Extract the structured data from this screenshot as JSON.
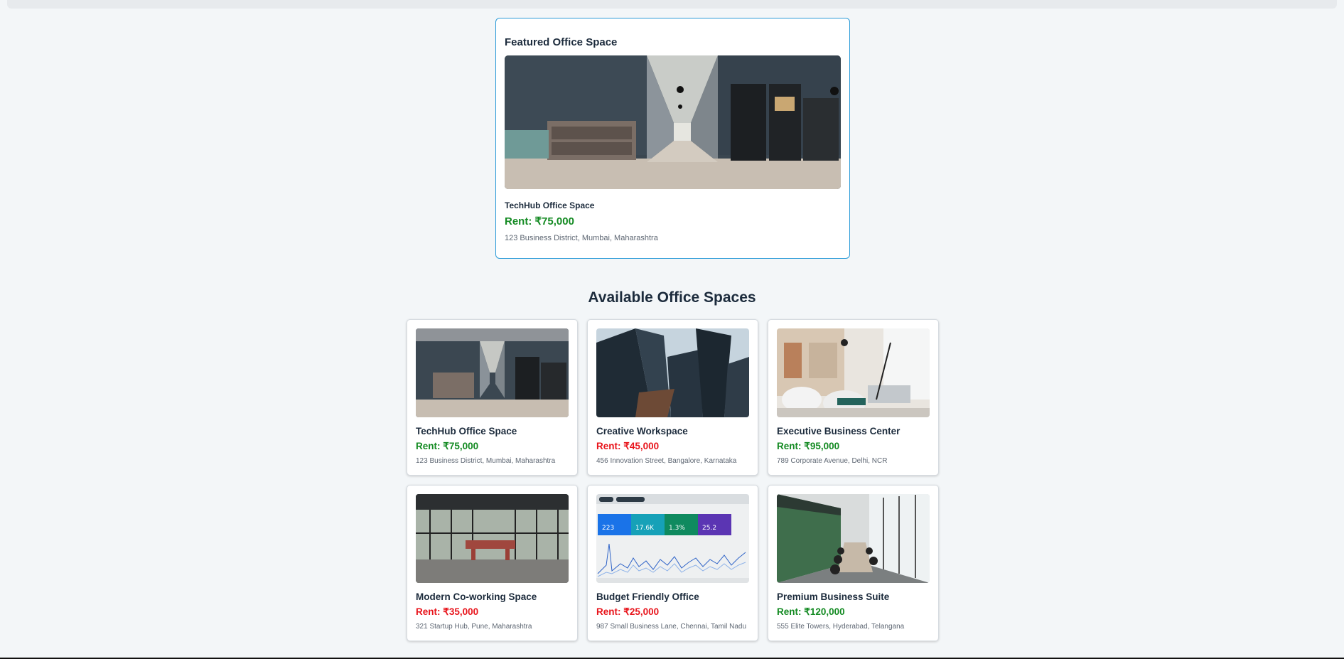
{
  "featured": {
    "heading": "Featured Office Space",
    "name": "TechHub Office Space",
    "rent": "Rent: ₹75,000",
    "address": "123 Business District, Mumbai, Maharashtra",
    "image": "office-corridor-photo"
  },
  "section": {
    "title": "Available Office Spaces"
  },
  "offices": [
    {
      "name": "TechHub Office Space",
      "rent": "Rent: ₹75,000",
      "rent_color": "#138a22",
      "address": "123 Business District, Mumbai, Maharashtra",
      "image": "office-corridor-photo"
    },
    {
      "name": "Creative Workspace",
      "rent": "Rent: ₹45,000",
      "rent_color": "#e8141b",
      "address": "456 Innovation Street, Bangalore, Karnataka",
      "image": "skyscrapers-photo"
    },
    {
      "name": "Executive Business Center",
      "rent": "Rent: ₹95,000",
      "rent_color": "#138a22",
      "address": "789 Corporate Avenue, Delhi, NCR",
      "image": "lounge-chairs-photo"
    },
    {
      "name": "Modern Co-working Space",
      "rent": "Rent: ₹35,000",
      "rent_color": "#e8141b",
      "address": "321 Startup Hub, Pune, Maharashtra",
      "image": "coworking-hall-photo"
    },
    {
      "name": "Budget Friendly Office",
      "rent": "Rent: ₹25,000",
      "rent_color": "#e8141b",
      "address": "987 Small Business Lane, Chennai, Tamil Nadu",
      "image": "analytics-dashboard-photo",
      "dashboard_stats": [
        "223",
        "17.6K",
        "1.3%",
        "25.2"
      ]
    },
    {
      "name": "Premium Business Suite",
      "rent": "Rent: ₹120,000",
      "rent_color": "#138a22",
      "address": "555 Elite Towers, Hyderabad, Telangana",
      "image": "conference-room-photo"
    }
  ]
}
